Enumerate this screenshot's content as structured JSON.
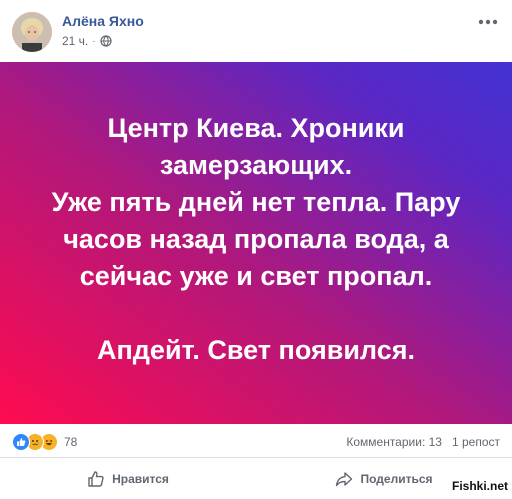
{
  "post": {
    "author": "Алёна Яхно",
    "time": "21 ч.",
    "separator": "·",
    "lines": [
      "Центр Киева. Хроники",
      "замерзающих.",
      "Уже пять дней нет тепла. Пару",
      "часов назад пропала вода, а",
      "сейчас уже и свет пропал.",
      "",
      "Апдейт. Свет появился."
    ]
  },
  "stats": {
    "reactions_count": "78",
    "comments": "Комментарии: 13",
    "shares": "1 репост"
  },
  "actions": {
    "like": "Нравится",
    "share": "Поделиться"
  },
  "watermark": "Fishki.net",
  "colors": {
    "gradient_start": "#ff0b4f",
    "gradient_end": "#4332d3",
    "author_link": "#385898",
    "like_blue": "#2d88ff",
    "emoji_yellow": "#f7b125"
  },
  "icons": {
    "more": "more-icon",
    "privacy": "globe-icon",
    "like": "thumbs-up-icon",
    "share": "share-arrow-icon"
  }
}
